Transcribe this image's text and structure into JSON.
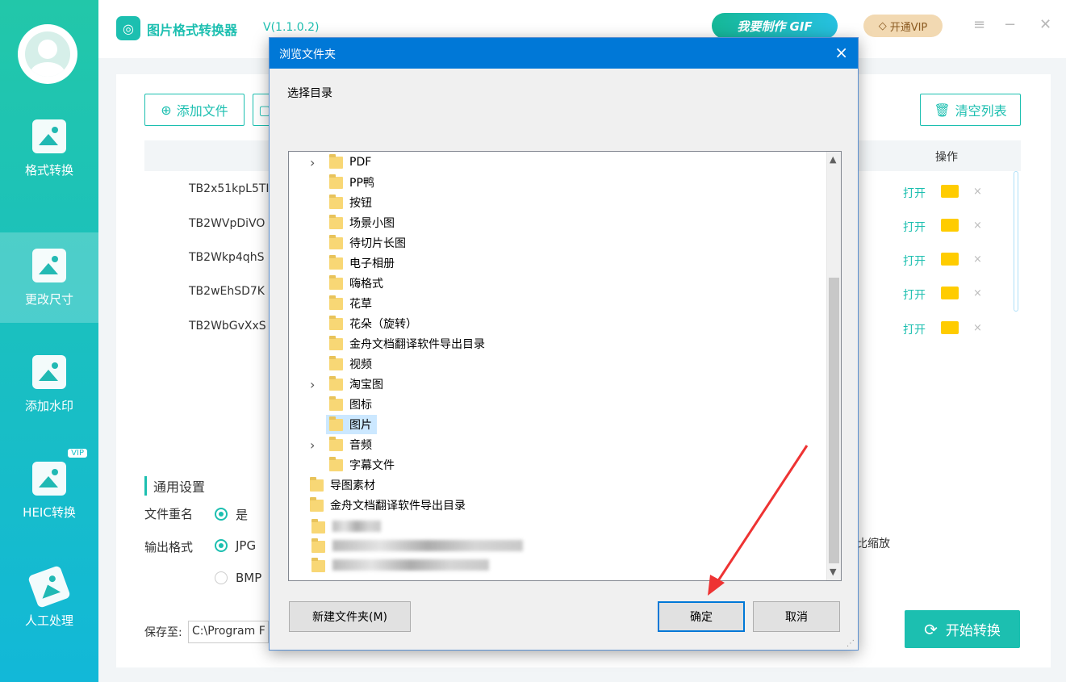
{
  "app": {
    "title": "图片格式转换器",
    "version": "V(1.1.0.2)",
    "gif_button": "我要制作 GIF",
    "vip_button": "开通VIP",
    "logo_icon": "image-icon"
  },
  "sidebar": {
    "items": [
      {
        "label": "格式转换",
        "icon": "image-convert-icon"
      },
      {
        "label": "更改尺寸",
        "icon": "image-resize-icon"
      },
      {
        "label": "添加水印",
        "icon": "watermark-icon"
      },
      {
        "label": "HEIC转换",
        "icon": "heic-icon",
        "badge": "VIP"
      },
      {
        "label": "人工处理",
        "icon": "manual-icon"
      }
    ],
    "active_index": 1
  },
  "toolbar": {
    "add_file": "添加文件",
    "clear_list": "清空列表"
  },
  "table": {
    "op_header": "操作",
    "rows": [
      {
        "name": "TB2x51kpL5TI",
        "open": "打开",
        "del": "×"
      },
      {
        "name": "TB2WVpDiVO",
        "open": "打开",
        "del": "×"
      },
      {
        "name": "TB2Wkp4qhS",
        "open": "打开",
        "del": "×"
      },
      {
        "name": "TB2wEhSD7K",
        "open": "打开",
        "del": "×"
      },
      {
        "name": "TB2WbGvXxS",
        "open": "打开",
        "del": "×"
      }
    ]
  },
  "settings": {
    "section_title": "通用设置",
    "rename_label": "文件重名",
    "rename_yes": "是",
    "format_label": "输出格式",
    "format_jpg": "JPG",
    "format_bmp": "BMP",
    "scale_text": "比缩放",
    "save_label": "保存至:",
    "save_path": "C:\\Program F",
    "start_button": "开始转换"
  },
  "dialog": {
    "title": "浏览文件夹",
    "close": "×",
    "prompt": "选择目录",
    "folders": [
      {
        "name": "PDF",
        "expand": true,
        "level": 1
      },
      {
        "name": "PP鸭",
        "expand": false,
        "level": 1
      },
      {
        "name": "按钮",
        "expand": false,
        "level": 1
      },
      {
        "name": "场景小图",
        "expand": false,
        "level": 1
      },
      {
        "name": "待切片长图",
        "expand": false,
        "level": 1
      },
      {
        "name": "电子相册",
        "expand": false,
        "level": 1
      },
      {
        "name": "嗨格式",
        "expand": false,
        "level": 1
      },
      {
        "name": "花草",
        "expand": false,
        "level": 1
      },
      {
        "name": "花朵（旋转）",
        "expand": false,
        "level": 1
      },
      {
        "name": "金舟文档翻译软件导出目录",
        "expand": false,
        "level": 1
      },
      {
        "name": "视频",
        "expand": false,
        "level": 1
      },
      {
        "name": "淘宝图",
        "expand": true,
        "level": 1
      },
      {
        "name": "图标",
        "expand": false,
        "level": 1
      },
      {
        "name": "图片",
        "expand": false,
        "level": 1,
        "selected": true
      },
      {
        "name": "音频",
        "expand": true,
        "level": 1
      },
      {
        "name": "字幕文件",
        "expand": false,
        "level": 1
      },
      {
        "name": "导图素材",
        "expand": false,
        "level": 0
      },
      {
        "name": "金舟文档翻译软件导出目录",
        "expand": false,
        "level": 0
      }
    ],
    "new_folder": "新建文件夹(M)",
    "ok": "确定",
    "cancel": "取消"
  },
  "colors": {
    "accent": "#1cbfb0",
    "dialog_title": "#0078d7",
    "annotation_arrow": "#ee3333"
  }
}
